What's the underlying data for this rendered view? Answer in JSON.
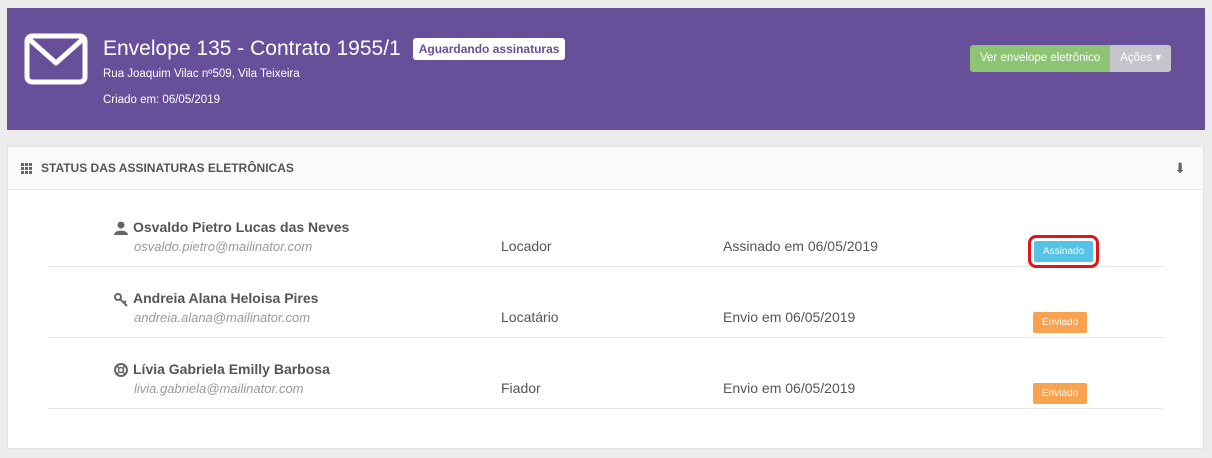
{
  "header": {
    "title": "Envelope 135 - Contrato 1955/1",
    "status_label": "Aguardando assinaturas",
    "address": "Rua Joaquim Vilac nº509, Vila Teixeira",
    "created": "Criado em: 06/05/2019",
    "view_button": "Ver envelope eletrônico",
    "actions_button": "Ações ▾"
  },
  "panel": {
    "title": "STATUS DAS ASSINATURAS ELETRÔNICAS"
  },
  "signers": [
    {
      "icon": "user-icon",
      "name": "Osvaldo Pietro Lucas das Neves",
      "email": "osvaldo.pietro@mailinator.com",
      "role": "Locador",
      "status_text": "Assinado em 06/05/2019",
      "badge": "Assinado",
      "badge_color": "#56c2e6"
    },
    {
      "icon": "key-icon",
      "name": "Andreia Alana Heloisa Pires",
      "email": "andreia.alana@mailinator.com",
      "role": "Locatário",
      "status_text": "Envio em 06/05/2019",
      "badge": "Enviado",
      "badge_color": "#f9a350"
    },
    {
      "icon": "lifebuoy-icon",
      "name": "Lívia Gabriela Emilly Barbosa",
      "email": "livia.gabriela@mailinator.com",
      "role": "Fiador",
      "status_text": "Envio em 06/05/2019",
      "badge": "Enviado",
      "badge_color": "#f9a350"
    }
  ],
  "colors": {
    "header_bg": "#674f9a",
    "accent_green": "#8cc474",
    "highlight_red": "#e3131c"
  }
}
